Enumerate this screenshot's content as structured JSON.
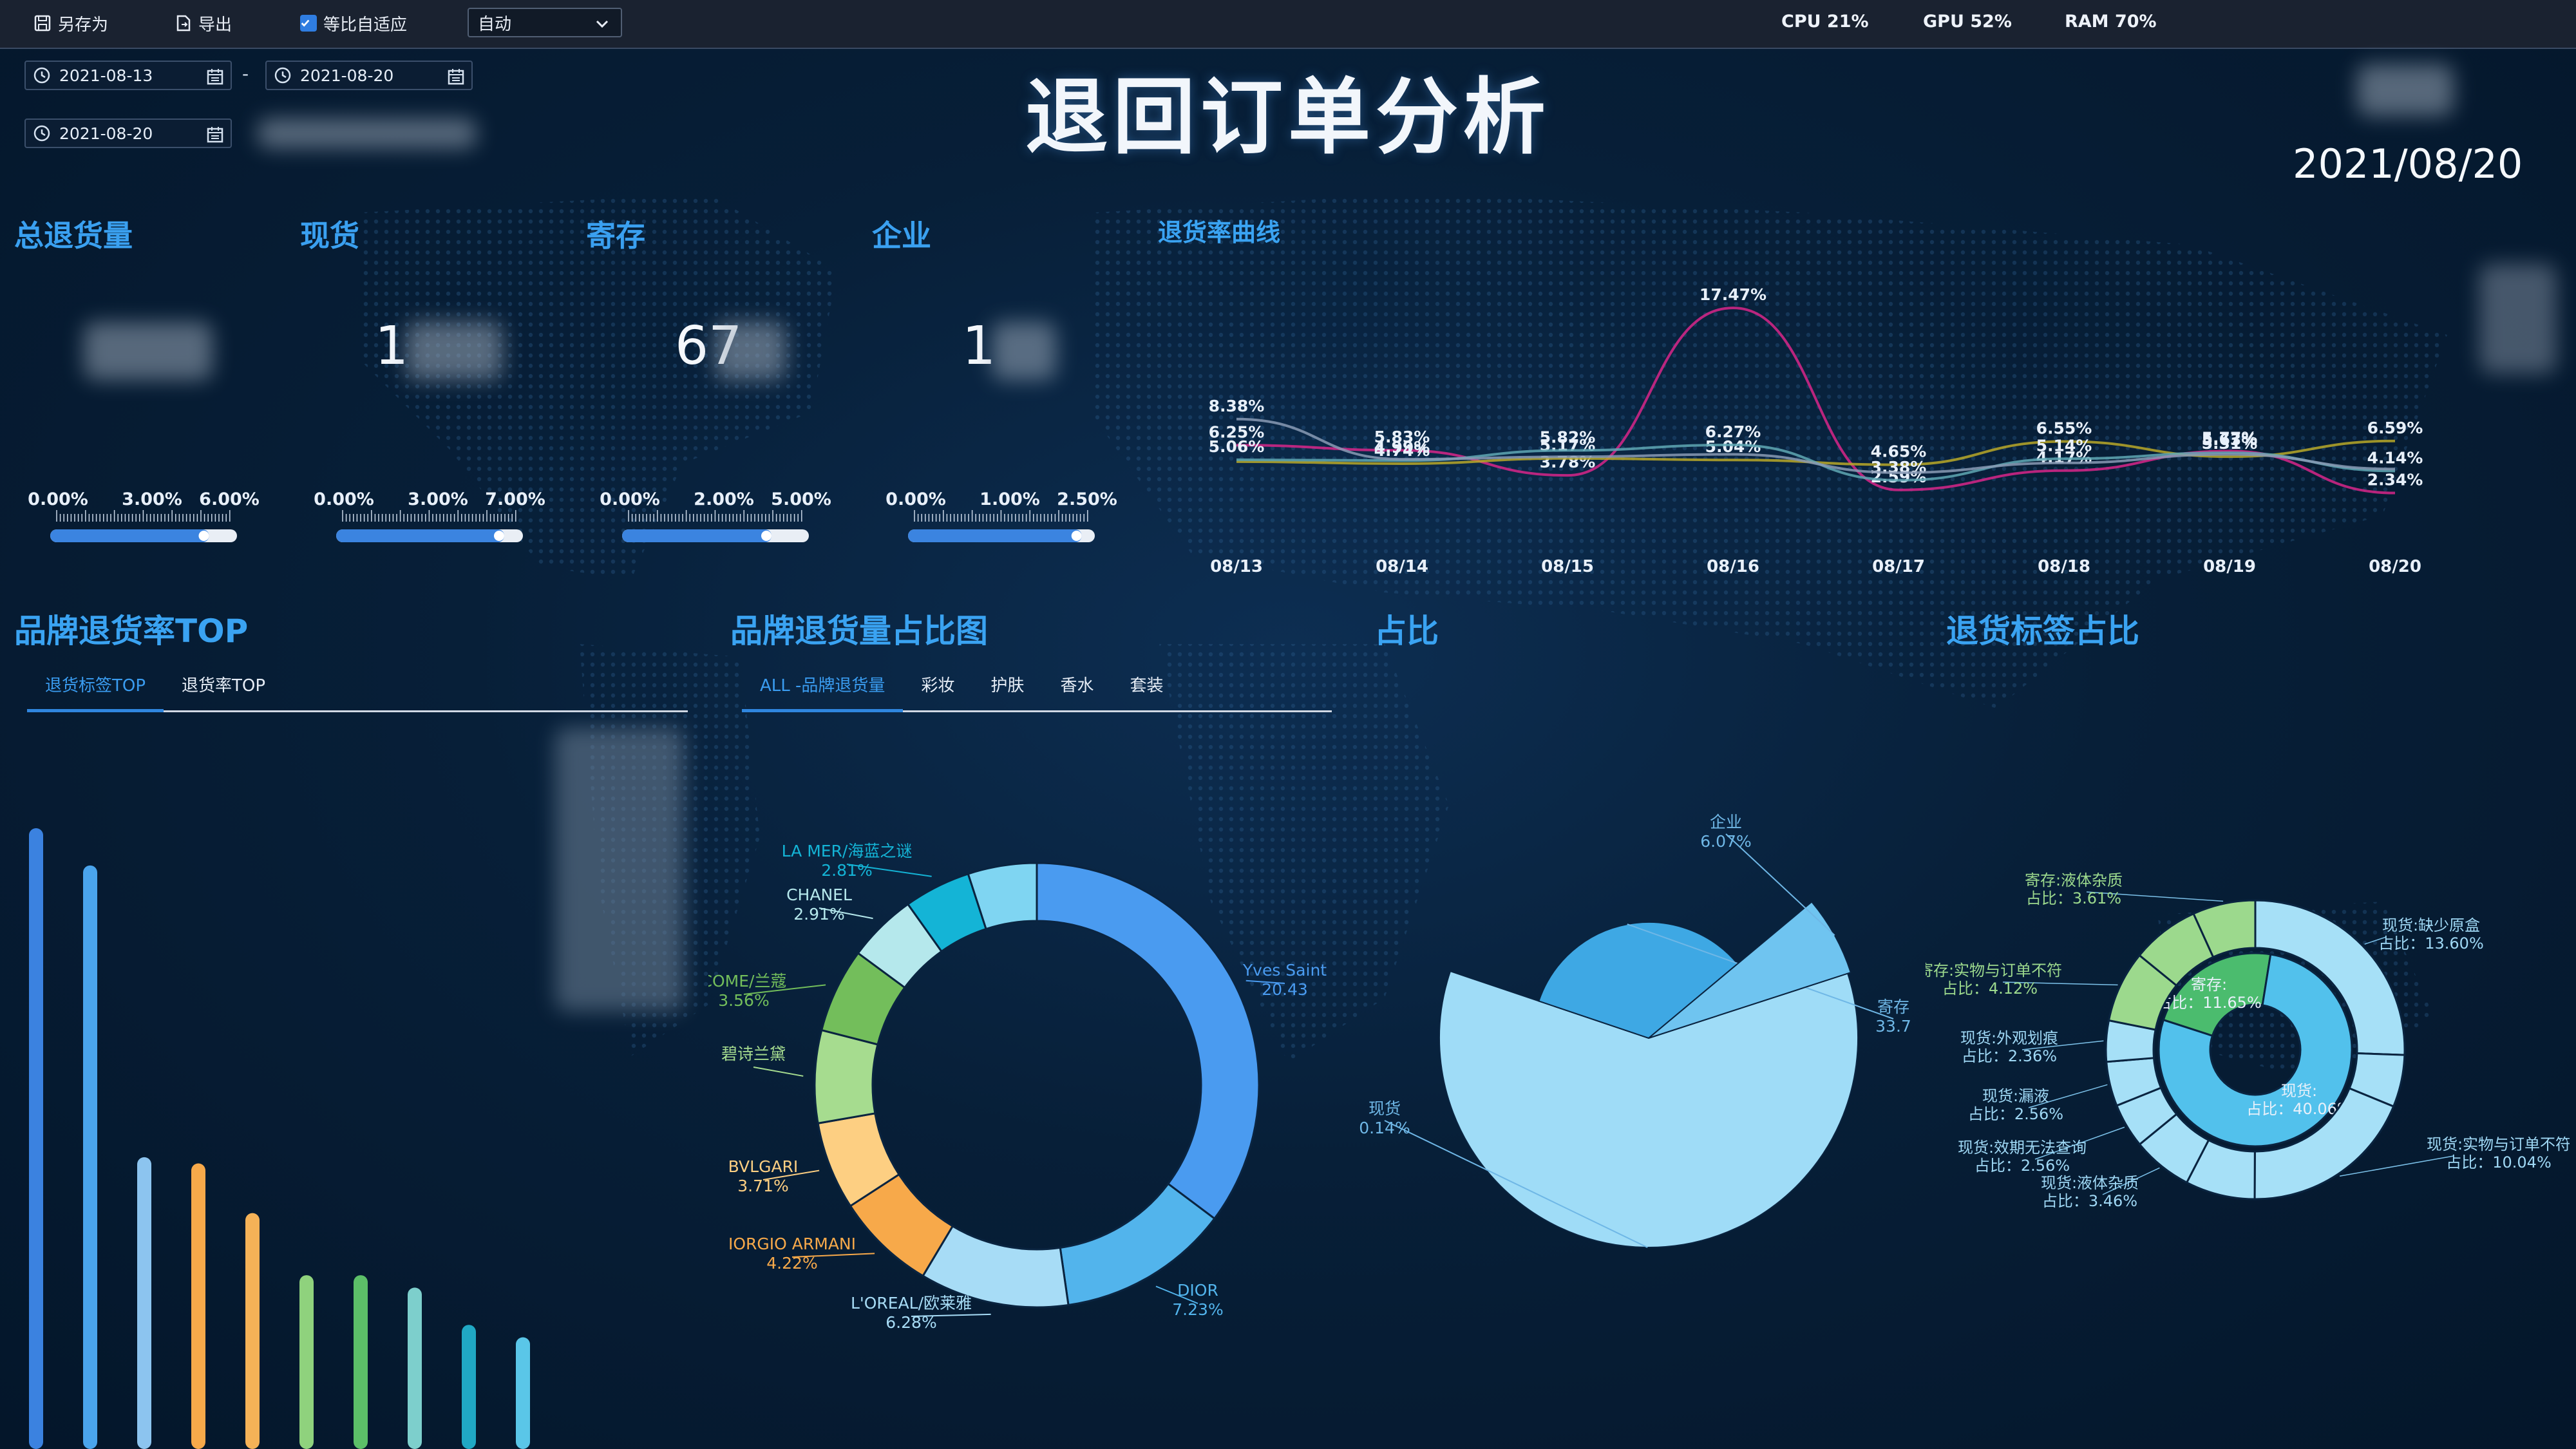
{
  "toolbar": {
    "save_as": "另存为",
    "export": "导出",
    "fit_label": "等比自适应",
    "fit_checked": true,
    "mode_select": "自动",
    "cpu": "CPU 21%",
    "gpu": "GPU 52%",
    "ram": "RAM 70%"
  },
  "filters": {
    "start_date": "2021-08-13",
    "range_sep": "-",
    "end_date": "2021-08-20",
    "single_date": "2021-08-20"
  },
  "page_title": "退回订单分析",
  "current_date": "2021/08/20",
  "kpis": [
    {
      "label": "总退货量",
      "value": "",
      "ticks": [
        "0.00%",
        "3.00%",
        "6.00%"
      ],
      "fill": 0.85
    },
    {
      "label": "现货",
      "value": "1",
      "ticks": [
        "0.00%",
        "3.00%",
        "7.00%"
      ],
      "fill": 0.9
    },
    {
      "label": "寄存",
      "value": "67",
      "ticks": [
        "0.00%",
        "2.00%",
        "5.00%"
      ],
      "fill": 0.8
    },
    {
      "label": "企业",
      "value": "1",
      "ticks": [
        "0.00%",
        "1.00%",
        "2.50%"
      ],
      "fill": 0.93
    }
  ],
  "sections": {
    "return_curve": "退货率曲线",
    "brand_top": "品牌退货率TOP",
    "brand_share": "品牌退货量占比图",
    "share": "占比",
    "tag_share": "退货标签占比"
  },
  "brand_top_tabs": [
    "退货标签TOP",
    "退货率TOP"
  ],
  "brand_share_tabs": [
    "ALL -品牌退货量",
    "彩妆",
    "护肤",
    "香水",
    "套装"
  ],
  "colors": {
    "accent": "#3aa0f0",
    "magenta": "#d8268a",
    "yellow": "#b9a828",
    "teal": "#5fa8b4",
    "slate": "#8a9bb5"
  },
  "chart_data": [
    {
      "type": "line",
      "title": "退货率曲线",
      "x": [
        "08/13",
        "08/14",
        "08/15",
        "08/16",
        "08/17",
        "08/18",
        "08/19",
        "08/20"
      ],
      "series": [
        {
          "values": [
            6.25,
            5.83,
            3.78,
            17.47,
            2.59,
            4.17,
            5.77,
            2.34
          ],
          "labels": [
            "6.25%",
            "5.83%",
            "3.78%",
            "17.47%",
            "2.59%",
            "4.17%",
            "5.77%",
            "2.34%"
          ]
        },
        {
          "values": [
            4.9,
            4.74,
            5.17,
            5.04,
            4.65,
            6.55,
            5.31,
            6.59
          ],
          "labels": [
            "",
            "4.74%",
            "5.17%",
            "5.04%",
            "4.65%",
            "6.55%",
            "5.31%",
            "6.59%"
          ]
        },
        {
          "values": [
            5.06,
            4.99,
            5.82,
            6.27,
            3.38,
            5.14,
            5.63,
            4.14
          ],
          "labels": [
            "5.06%",
            "4.99%",
            "5.82%",
            "6.27%",
            "3.38%",
            "5.14%",
            "5.63%",
            "4.14%"
          ]
        },
        {
          "values": [
            8.38,
            5.1,
            5.3,
            5.5,
            4.0,
            4.8,
            5.5,
            4.3
          ],
          "labels": [
            "8.38%",
            "",
            "",
            "",
            "",
            "",
            "",
            ""
          ]
        }
      ],
      "ylim": [
        0,
        20
      ]
    },
    {
      "type": "bar",
      "title": "品牌退货率TOP",
      "values": [
        100,
        94,
        47,
        46,
        38,
        28,
        28,
        26,
        20,
        18
      ],
      "colors": [
        "#3b82e0",
        "#4aa4ec",
        "#8cc4ef",
        "#f7a94a",
        "#f5b257",
        "#8fd27d",
        "#5cbf68",
        "#7dcfcc",
        "#20a8c4",
        "#5ac6e8"
      ],
      "ylim": [
        0,
        100
      ]
    },
    {
      "type": "pie",
      "title": "品牌退货量占比图",
      "slices": [
        {
          "label": "Yves Saint",
          "pct": "20.43",
          "value": 20.43,
          "color": "#4a9bf0"
        },
        {
          "label": "DIOR",
          "pct": "7.23%",
          "value": 7.23,
          "color": "#52b4ec"
        },
        {
          "label": "L'OREAL/欧莱雅",
          "pct": "6.28%",
          "value": 6.28,
          "color": "#a7dcf6"
        },
        {
          "label": "IORGIO ARMANI",
          "pct": "4.22%",
          "value": 4.22,
          "color": "#f7a94a"
        },
        {
          "label": "BVLGARI",
          "pct": "3.71%",
          "value": 3.71,
          "color": "#fdcf82"
        },
        {
          "label": "碧诗兰黛",
          "pct": "",
          "value": 3.9,
          "color": "#a6dc8f"
        },
        {
          "label": "COME/兰蔻",
          "pct": "3.56%",
          "value": 3.56,
          "color": "#73be5b"
        },
        {
          "label": "CHANEL",
          "pct": "2.91%",
          "value": 2.91,
          "color": "#b5e8ec"
        },
        {
          "label": "LA MER/海蓝之谜",
          "pct": "2.81%",
          "value": 2.81,
          "color": "#14b4d6"
        },
        {
          "label": "",
          "pct": "",
          "value": 2.9,
          "color": "#7fd5f2"
        }
      ]
    },
    {
      "type": "pie",
      "title": "占比",
      "slices": [
        {
          "label": "现货",
          "pct": "0.14%",
          "value": 60.1,
          "color": "#9fdcf7"
        },
        {
          "label": "寄存",
          "pct": "33.7",
          "value": 33.7,
          "color": "#3ea8e4"
        },
        {
          "label": "企业",
          "pct": "6.07%",
          "value": 6.07,
          "color": "#6fc4f0"
        }
      ]
    },
    {
      "type": "pie",
      "title": "退货标签占比",
      "inner": [
        {
          "label": "寄存:",
          "pct": "占比：11.65%",
          "value": 11.65,
          "color": "#4bbc6e"
        },
        {
          "label": "现货:",
          "pct": "占比：40.06%",
          "value": 40.06,
          "color": "#52c1ec"
        }
      ],
      "outer": [
        {
          "label": "现货:缺少原盒",
          "pct": "占比：13.60%",
          "value": 13.6,
          "color": "#a6e0f7"
        },
        {
          "label": "",
          "pct": "",
          "value": 3.0,
          "color": "#a6e0f7"
        },
        {
          "label": "现货:实物与订单不符",
          "pct": "占比：10.04%",
          "value": 10.04,
          "color": "#a6e0f7"
        },
        {
          "label": "",
          "pct": "",
          "value": 4.0,
          "color": "#a6e0f7"
        },
        {
          "label": "现货:液体杂质",
          "pct": "占比：3.46%",
          "value": 3.46,
          "color": "#a6e0f7"
        },
        {
          "label": "现货:效期无法查询",
          "pct": "占比：2.56%",
          "value": 2.56,
          "color": "#a6e0f7"
        },
        {
          "label": "现货:漏液",
          "pct": "占比：2.56%",
          "value": 2.56,
          "color": "#a6e0f7"
        },
        {
          "label": "现货:外观划痕",
          "pct": "占比：2.36%",
          "value": 2.36,
          "color": "#a6e0f7"
        },
        {
          "label": "寄存:实物与订单不符",
          "pct": "占比：4.12%",
          "value": 4.12,
          "color": "#9cd98d"
        },
        {
          "label": "",
          "pct": "",
          "value": 3.9,
          "color": "#9cd98d"
        },
        {
          "label": "寄存:液体杂质",
          "pct": "占比：3.61%",
          "value": 3.61,
          "color": "#9cd98d"
        }
      ]
    }
  ]
}
